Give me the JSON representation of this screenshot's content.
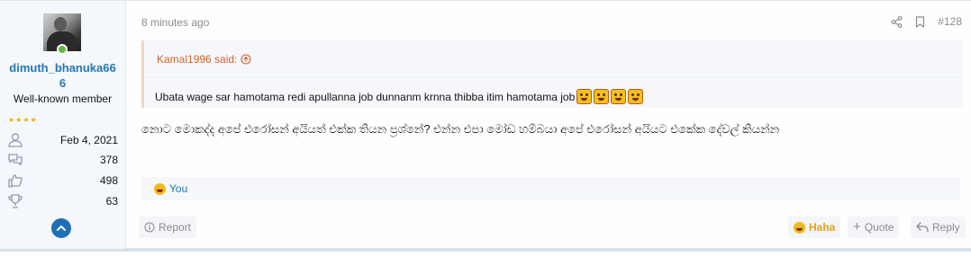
{
  "user": {
    "name": "dimuth_bhanuka666",
    "name_line1": "dimuth_bhanuka66",
    "name_line2": "6",
    "title": "Well-known member",
    "stars": "★★★★",
    "stats": [
      {
        "icon": "user-icon",
        "value": "Feb 4, 2021"
      },
      {
        "icon": "messages-icon",
        "value": "378"
      },
      {
        "icon": "thumbs-up-icon",
        "value": "498"
      },
      {
        "icon": "trophy-icon",
        "value": "63"
      }
    ]
  },
  "post": {
    "time": "8 minutes ago",
    "number": "#128",
    "quote_author": "Kamal1996 said:",
    "quote_text": "Ubata wage sar hamotama redi apullanna job dunnanm krnna thibba itim hamotama job",
    "quote_emoji_count": 4,
    "message": "නොට මොකද්ද අපේ එරෝසන් අයියත් එක්ක තියන ප්‍රශ්නේ? එන්න එපා මෝඩ හම්බයා අපේ එරෝසන් අයියට එකේක දේවල් කියන්න",
    "reaction_text": "You"
  },
  "footer": {
    "report": "Report",
    "haha": "Haha",
    "quote": "Quote",
    "reply": "Reply"
  },
  "colors": {
    "username": "#2577b1",
    "quote_author": "#d2632c",
    "haha": "#e3a21a",
    "online": "#63b545",
    "scroll_button": "#1f6fb5"
  }
}
